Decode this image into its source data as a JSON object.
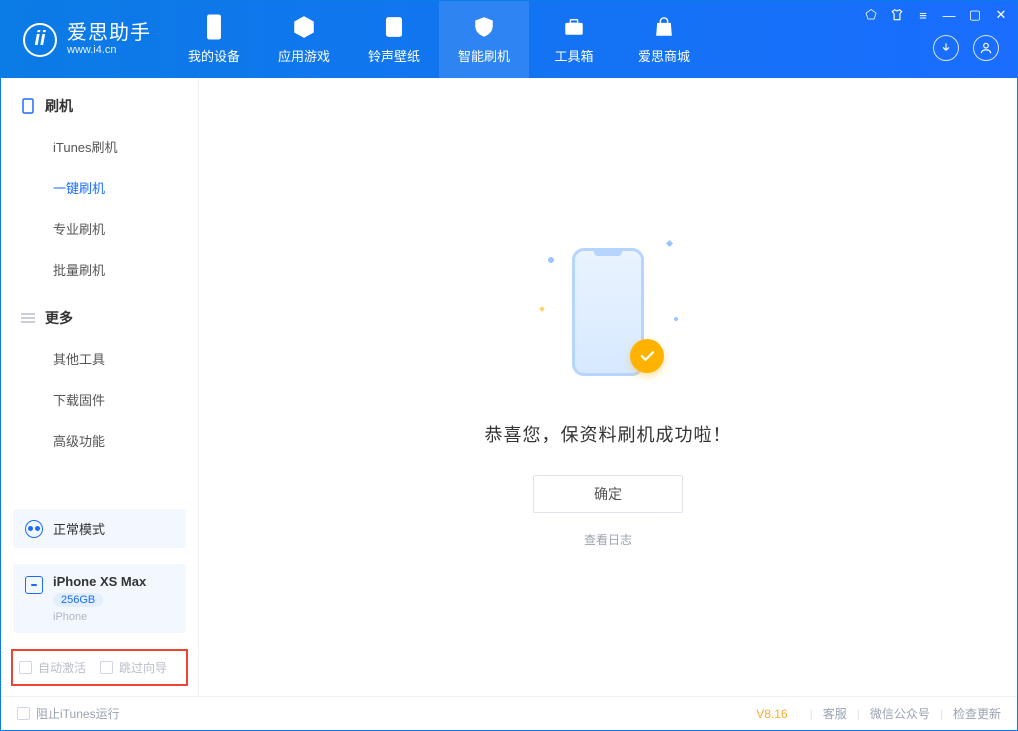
{
  "app": {
    "name_cn": "爱思助手",
    "name_en": "www.i4.cn"
  },
  "nav": {
    "my_device": "我的设备",
    "apps_games": "应用游戏",
    "ringtones": "铃声壁纸",
    "smart_flash": "智能刷机",
    "toolbox": "工具箱",
    "store": "爱思商城"
  },
  "sidebar": {
    "flash_section": "刷机",
    "items": {
      "itunes": "iTunes刷机",
      "onekey": "一键刷机",
      "pro": "专业刷机",
      "batch": "批量刷机"
    },
    "more_section": "更多",
    "more": {
      "other_tools": "其他工具",
      "download_fw": "下载固件",
      "advanced": "高级功能"
    }
  },
  "mode": {
    "label": "正常模式"
  },
  "device": {
    "name": "iPhone XS Max",
    "capacity": "256GB",
    "type": "iPhone"
  },
  "bottom_opts": {
    "auto_activate": "自动激活",
    "skip_guide": "跳过向导"
  },
  "main": {
    "success_text": "恭喜您，保资料刷机成功啦！",
    "confirm": "确定",
    "view_log": "查看日志"
  },
  "footer": {
    "block_itunes": "阻止iTunes运行",
    "version": "V8.16",
    "support": "客服",
    "wechat": "微信公众号",
    "update": "检查更新"
  }
}
